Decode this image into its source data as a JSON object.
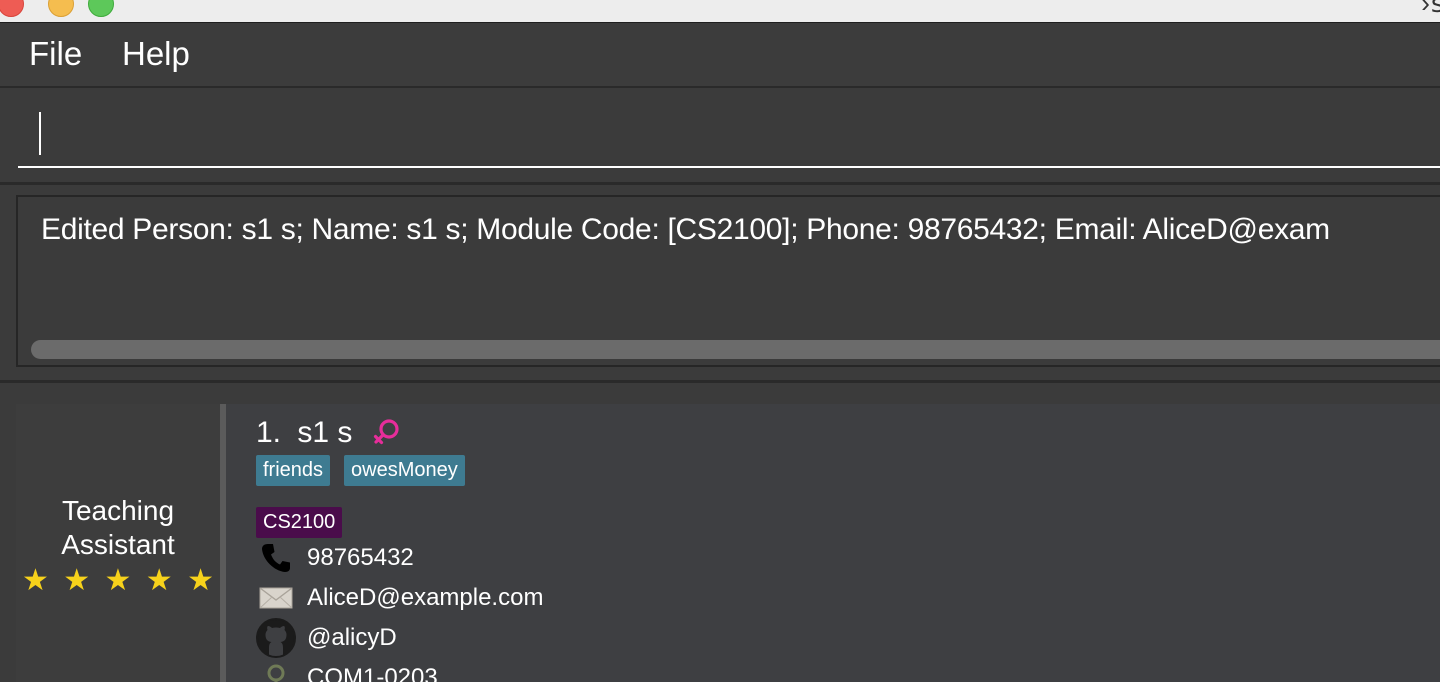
{
  "menu": {
    "file_label": "File",
    "help_label": "Help"
  },
  "command": {
    "value": ""
  },
  "result": {
    "text": "Edited Person: s1 s; Name: s1 s; Module Code: [CS2100]; Phone: 98765432; Email: AliceD@exam"
  },
  "person": {
    "index": "1.",
    "name": "s1 s",
    "gender_icon": "female-symbol-icon",
    "role": [
      "Teaching",
      "Assistant"
    ],
    "rating": 5,
    "tags": [
      "friends",
      "owesMoney"
    ],
    "module_code": "CS2100",
    "phone": "98765432",
    "email": "AliceD@example.com",
    "github": "@alicyD",
    "location": "COM1-0203"
  },
  "colors": {
    "background": "#3b3b3b",
    "tag": "#3e7b91",
    "module_tag": "#4a0c4b",
    "star": "#f7d21b",
    "gender": "#e62d9a"
  }
}
